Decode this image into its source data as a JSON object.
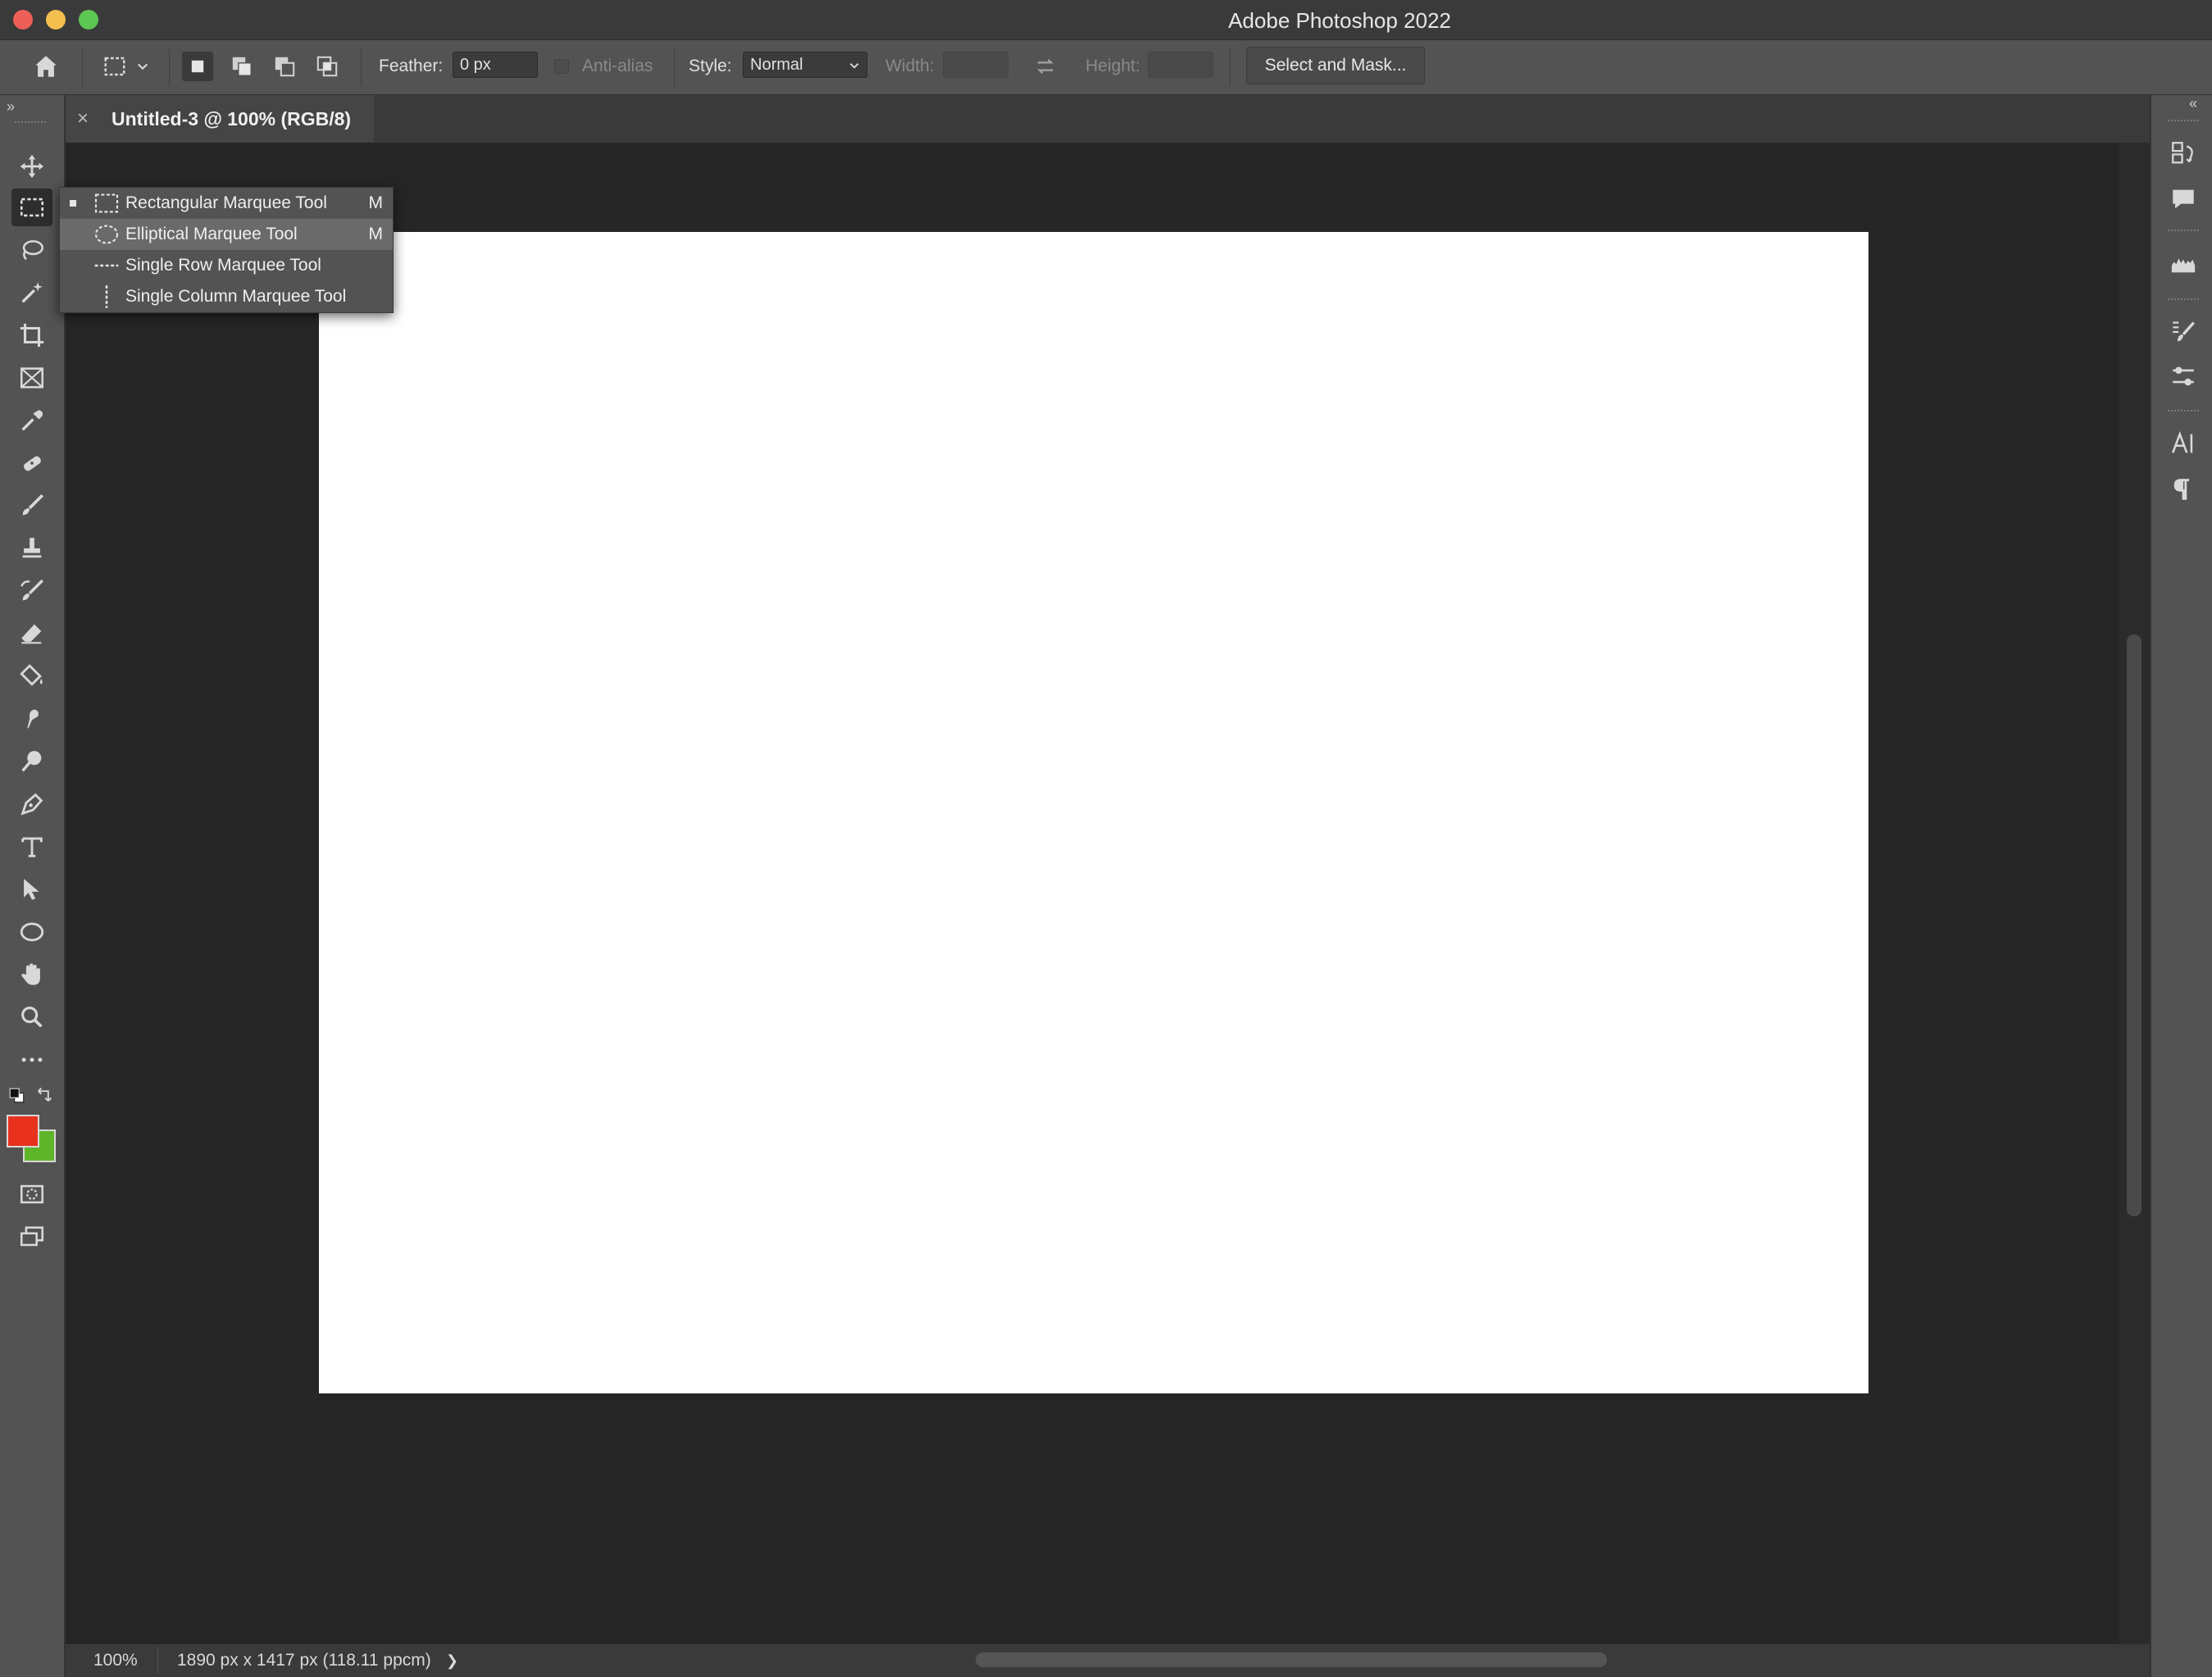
{
  "window": {
    "title": "Adobe Photoshop 2022",
    "traffic_lights": {
      "close": "#ec5f57",
      "minimize": "#f5bf4f",
      "zoom": "#5ec653"
    }
  },
  "options_bar": {
    "feather_label": "Feather:",
    "feather_value": "0 px",
    "antialias_label": "Anti-alias",
    "style_label": "Style:",
    "style_value": "Normal",
    "width_label": "Width:",
    "height_label": "Height:",
    "select_mask_button": "Select and Mask..."
  },
  "document_tab": {
    "close_glyph": "×",
    "title": "Untitled-3 @ 100% (RGB/8)"
  },
  "toolbar": {
    "tools": [
      "move-icon",
      "rectangular-marquee-icon",
      "lasso-icon",
      "magic-wand-icon",
      "crop-icon",
      "frame-icon",
      "eyedropper-icon",
      "healing-brush-icon",
      "brush-icon",
      "clone-stamp-icon",
      "history-brush-icon",
      "eraser-icon",
      "paint-bucket-icon",
      "smudge-icon",
      "dodge-icon",
      "pen-icon",
      "type-icon",
      "path-selection-icon",
      "ellipse-icon",
      "hand-icon",
      "zoom-icon",
      "more-tools-icon"
    ],
    "foreground_color": "#e8321e",
    "background_color": "#5fb52a"
  },
  "flyout": {
    "items": [
      {
        "label": "Rectangular Marquee Tool",
        "shortcut": "M",
        "selected": true
      },
      {
        "label": "Elliptical Marquee Tool",
        "shortcut": "M",
        "highlighted": true
      },
      {
        "label": "Single Row Marquee Tool",
        "shortcut": ""
      },
      {
        "label": "Single Column Marquee Tool",
        "shortcut": ""
      }
    ]
  },
  "status_bar": {
    "zoom": "100%",
    "doc_info": "1890 px x 1417 px (118.11 ppcm)",
    "arrow": "❯"
  },
  "right_panel": {
    "icons": [
      "history-icon",
      "comments-icon",
      "histogram-icon",
      "brush-settings-icon",
      "adjustments-icon",
      "character-icon",
      "paragraph-icon"
    ]
  }
}
